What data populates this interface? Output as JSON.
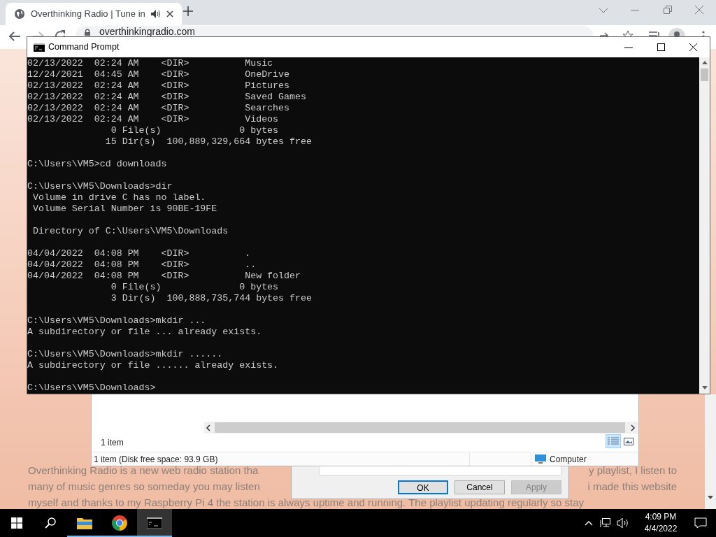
{
  "browser": {
    "tab": {
      "title": "Overthinking Radio | Tune in",
      "audio_playing": true
    },
    "address": "overthinkingradio.com"
  },
  "page": {
    "lines": [
      {
        "left": "Overthinking Radio is a new web radio station tha",
        "right": "y playlist, I listen to"
      },
      {
        "left": "many of music genres so someday you may listen",
        "right": "i made this website"
      },
      {
        "left": "myself and thanks to my Raspberry Pi 4 the station is always uptime and running. The playlist updating regularly so stay"
      }
    ]
  },
  "explorer": {
    "item_count": "1 item",
    "status": "1 item (Disk free space: 93.9 GB)",
    "location": "Computer",
    "views": [
      {
        "kind": "details",
        "selected": true
      },
      {
        "kind": "thumbnails",
        "selected": false
      }
    ]
  },
  "dialog": {
    "buttons": [
      {
        "label": "OK",
        "default": true,
        "disabled": false
      },
      {
        "label": "Cancel",
        "default": false,
        "disabled": false
      },
      {
        "label": "Apply",
        "default": false,
        "disabled": true
      }
    ]
  },
  "console": {
    "title": "Command Prompt",
    "blocks": [
      [
        "02/13/2022  02:24 AM    <DIR>          Music",
        "12/24/2021  04:45 AM    <DIR>          OneDrive",
        "02/13/2022  02:24 AM    <DIR>          Pictures",
        "02/13/2022  02:24 AM    <DIR>          Saved Games",
        "02/13/2022  02:24 AM    <DIR>          Searches",
        "02/13/2022  02:24 AM    <DIR>          Videos",
        "               0 File(s)              0 bytes",
        "              15 Dir(s)  100,889,329,664 bytes free"
      ],
      [
        "C:\\Users\\VM5>cd downloads"
      ],
      [
        "C:\\Users\\VM5\\Downloads>dir",
        " Volume in drive C has no label.",
        " Volume Serial Number is 90BE-19FE"
      ],
      [
        " Directory of C:\\Users\\VM5\\Downloads"
      ],
      [
        "04/04/2022  04:08 PM    <DIR>          .",
        "04/04/2022  04:08 PM    <DIR>          ..",
        "04/04/2022  04:08 PM    <DIR>          New folder",
        "               0 File(s)              0 bytes",
        "               3 Dir(s)  100,888,735,744 bytes free"
      ],
      [
        "C:\\Users\\VM5\\Downloads>mkdir ...",
        "A subdirectory or file ... already exists."
      ],
      [
        "C:\\Users\\VM5\\Downloads>mkdir ......",
        "A subdirectory or file ...... already exists."
      ],
      [
        "C:\\Users\\VM5\\Downloads>"
      ]
    ]
  },
  "taskbar": {
    "apps": [
      {
        "kind": "explorer",
        "running": true,
        "active": false
      },
      {
        "kind": "chrome",
        "running": true,
        "active": false
      },
      {
        "kind": "cmd",
        "running": true,
        "active": true
      }
    ],
    "time": "4:09 PM",
    "date": "4/4/2022"
  }
}
